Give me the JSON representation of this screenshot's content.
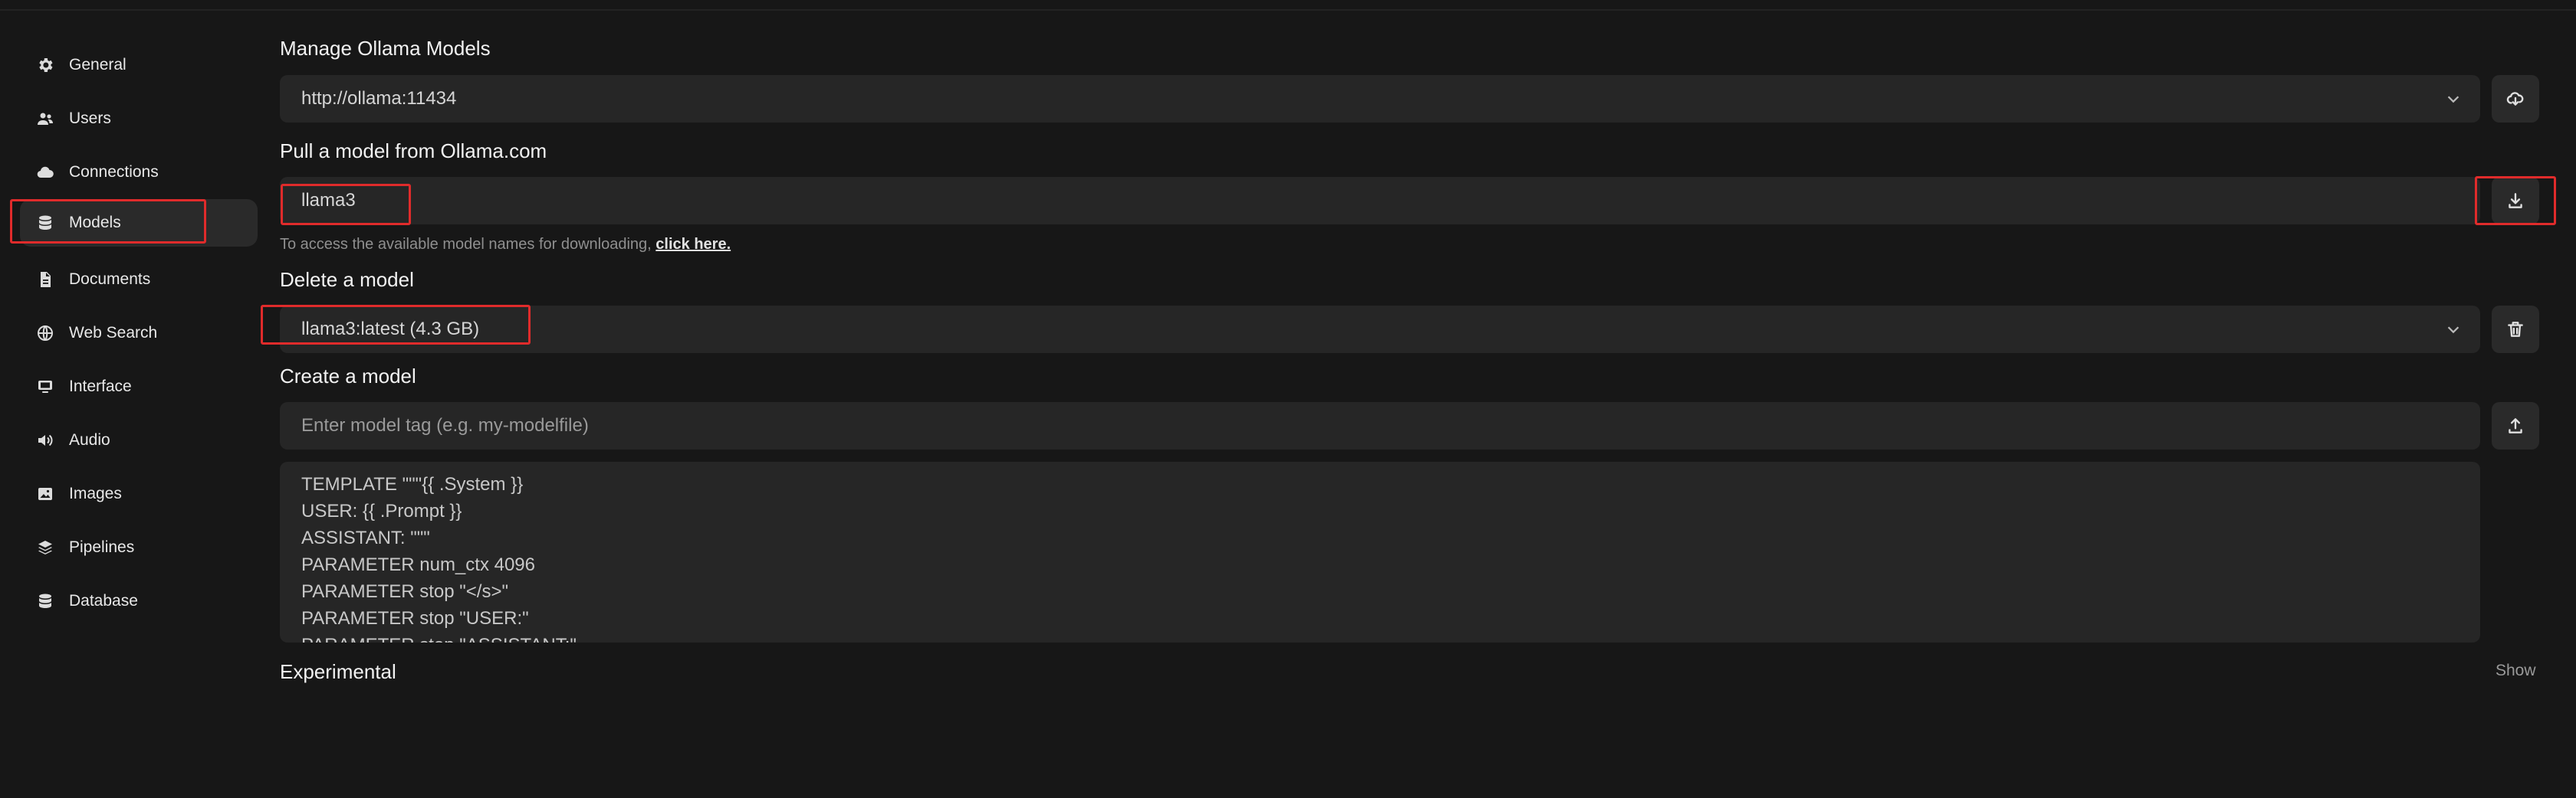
{
  "sidebar": {
    "items": [
      {
        "label": "General",
        "icon": "gear-icon"
      },
      {
        "label": "Users",
        "icon": "users-icon"
      },
      {
        "label": "Connections",
        "icon": "cloud-icon"
      },
      {
        "label": "Models",
        "icon": "database-icon"
      },
      {
        "label": "Documents",
        "icon": "document-icon"
      },
      {
        "label": "Web Search",
        "icon": "globe-icon"
      },
      {
        "label": "Interface",
        "icon": "monitor-icon"
      },
      {
        "label": "Audio",
        "icon": "speaker-icon"
      },
      {
        "label": "Images",
        "icon": "image-icon"
      },
      {
        "label": "Pipelines",
        "icon": "layers-icon"
      },
      {
        "label": "Database",
        "icon": "database-icon"
      }
    ],
    "active": "Models"
  },
  "manage": {
    "title": "Manage Ollama Models",
    "url_value": "http://ollama:11434",
    "button_icon": "download-cloud-icon"
  },
  "pull": {
    "title": "Pull a model from Ollama.com",
    "input_value": "llama3",
    "button_icon": "download-icon",
    "help_text": "To access the available model names for downloading, ",
    "help_link": "click here."
  },
  "delete": {
    "title": "Delete a model",
    "selected": "llama3:latest (4.3 GB)",
    "button_icon": "trash-icon"
  },
  "create": {
    "title": "Create a model",
    "tag_placeholder": "Enter model tag (e.g. my-modelfile)",
    "button_icon": "upload-icon",
    "modelfile_lines": [
      "TEMPLATE \"\"\"{{ .System }}",
      "USER: {{ .Prompt }}",
      "ASSISTANT: \"\"\"",
      "PARAMETER num_ctx 4096",
      "PARAMETER stop \"</s>\"",
      "PARAMETER stop \"USER:\"",
      "PARAMETER stop \"ASSISTANT:\""
    ]
  },
  "experimental": {
    "title": "Experimental",
    "toggle_label": "Show"
  },
  "colors": {
    "background": "#171717",
    "field": "#262626",
    "highlight": "#e02b2b"
  }
}
